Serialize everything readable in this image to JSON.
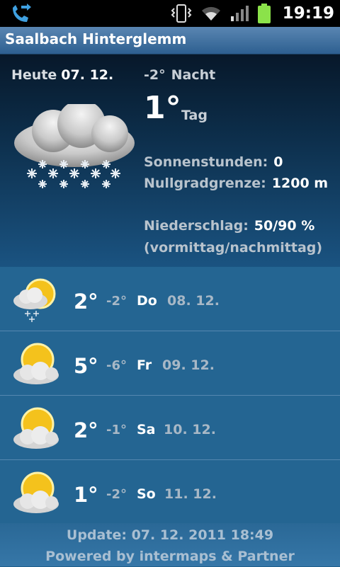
{
  "status_bar": {
    "time": "19:19",
    "icons": [
      "call-forward-icon",
      "vibrate-icon",
      "wifi-icon",
      "signal-icon",
      "battery-icon"
    ]
  },
  "header": {
    "title": "Saalbach Hinterglemm"
  },
  "today": {
    "label": "Heute",
    "date": "07. 12.",
    "night_temp": "-2°",
    "night_label": "Nacht",
    "day_temp": "1°",
    "day_label": "Tag",
    "sunshine_label": "Sonnenstunden:",
    "sunshine_value": "0",
    "freezing_label": "Nullgradgrenze:",
    "freezing_value": "1200 m",
    "precip_label": "Niederschlag:",
    "precip_value": "50/90 %",
    "precip_note": "(vormittag/nachmittag)",
    "icon": "snow-cloud-icon"
  },
  "forecast": [
    {
      "max": "2°",
      "min": "-2°",
      "day": "Do",
      "date": "08. 12.",
      "icon": "sun-cloud-snow-icon"
    },
    {
      "max": "5°",
      "min": "-6°",
      "day": "Fr",
      "date": "09. 12.",
      "icon": "sun-cloud-icon"
    },
    {
      "max": "2°",
      "min": "-1°",
      "day": "Sa",
      "date": "10. 12.",
      "icon": "sun-cloud-icon"
    },
    {
      "max": "1°",
      "min": "-2°",
      "day": "So",
      "date": "11. 12.",
      "icon": "sun-cloud-icon"
    }
  ],
  "footer": {
    "update_label": "Update:",
    "update_value": "07. 12. 2011 18:49",
    "powered_by": "Powered by intermaps & Partner"
  },
  "colors": {
    "accent": "#1f5f8c",
    "title_bar": "#3a6d9e"
  }
}
